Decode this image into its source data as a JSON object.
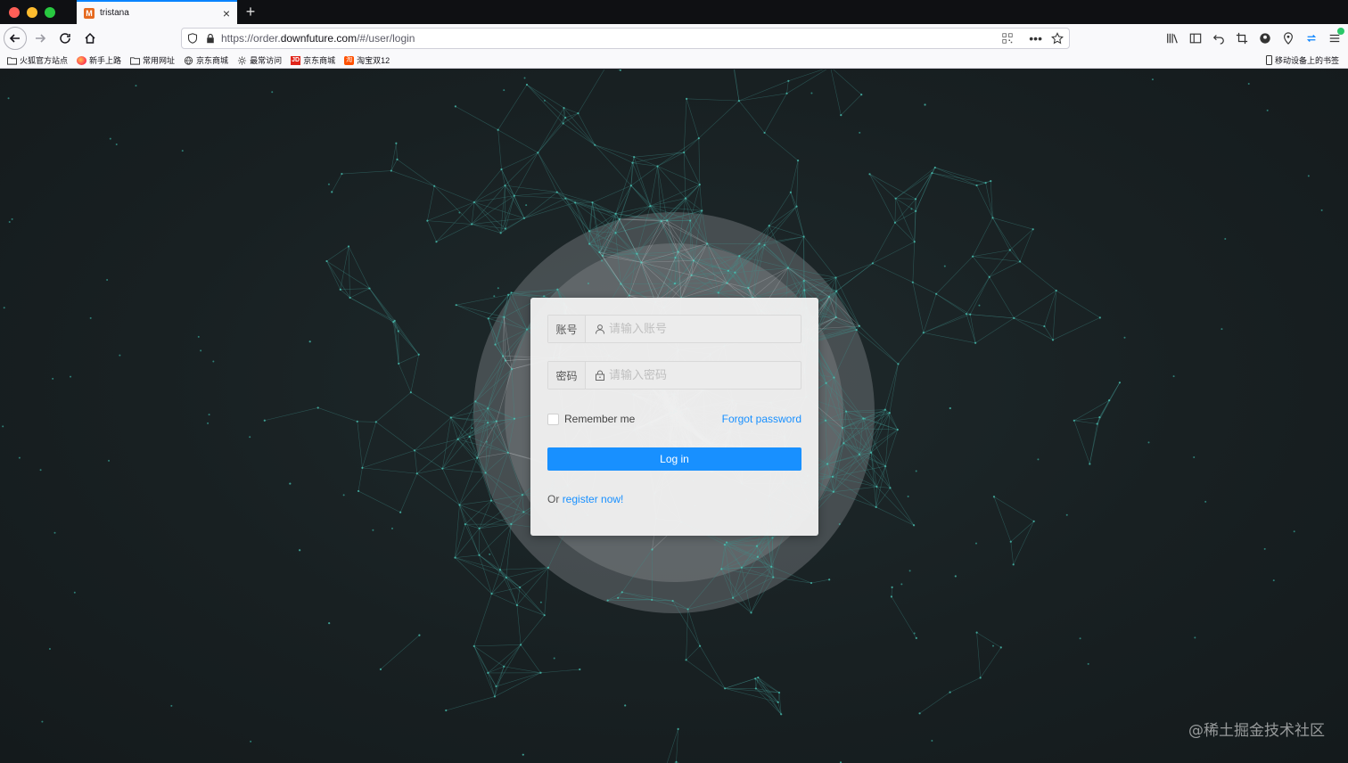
{
  "browser": {
    "tab_title": "tristana",
    "tab_favicon": "M",
    "new_tab": "+",
    "url_prefix": "https://order.",
    "url_host": "downfuture.com",
    "url_path": "/#/user/login"
  },
  "bookmarks": {
    "items": [
      {
        "label": "火狐官方站点",
        "icon": "folder-icon"
      },
      {
        "label": "新手上路",
        "icon": "firefox-icon"
      },
      {
        "label": "常用网址",
        "icon": "folder-icon"
      },
      {
        "label": "京东商城",
        "icon": "globe-icon"
      },
      {
        "label": "最常访问",
        "icon": "gear-icon"
      },
      {
        "label": "京东商城",
        "icon": "jd-icon"
      },
      {
        "label": "淘宝双12",
        "icon": "taobao-icon"
      }
    ],
    "mobile_label": "移动设备上的书签"
  },
  "login": {
    "account_label": "账号",
    "account_placeholder": "请输入账号",
    "password_label": "密码",
    "password_placeholder": "请输入密码",
    "remember_label": "Remember me",
    "forgot_label": "Forgot password",
    "login_label": "Log in",
    "or_text": "Or",
    "register_label": "register now!"
  },
  "watermark": "@稀土掘金技术社区",
  "colors": {
    "primary": "#1890ff",
    "tab_accent": "#0a84ff"
  }
}
